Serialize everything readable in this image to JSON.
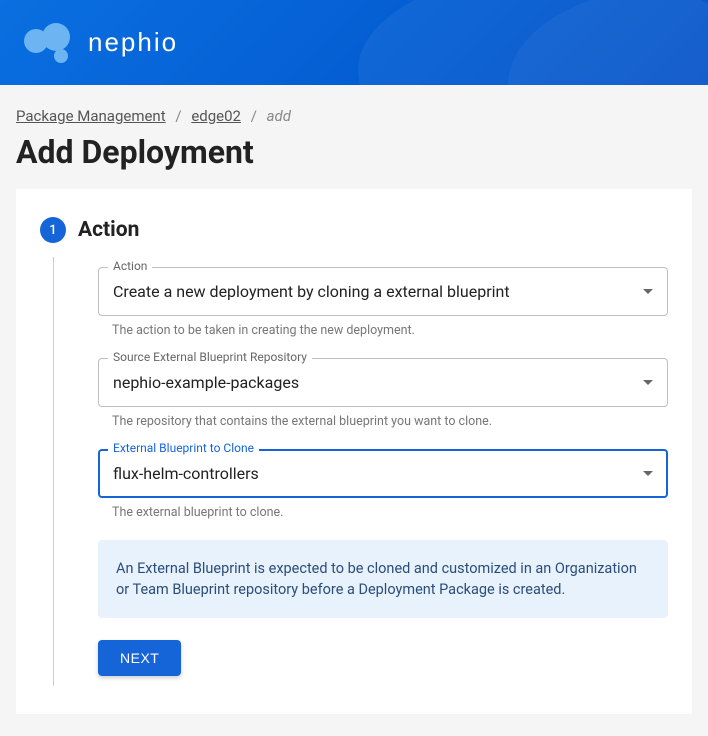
{
  "brand": "nephio",
  "breadcrumb": {
    "item0": "Package Management",
    "item1": "edge02",
    "current": "add"
  },
  "page_title": "Add Deployment",
  "step": {
    "number": "1",
    "title": "Action"
  },
  "fields": {
    "action": {
      "label": "Action",
      "value": "Create a new deployment by cloning a external blueprint",
      "helper": "The action to be taken in creating the new deployment."
    },
    "source_repo": {
      "label": "Source External Blueprint Repository",
      "value": "nephio-example-packages",
      "helper": "The repository that contains the external blueprint you want to clone."
    },
    "blueprint": {
      "label": "External Blueprint to Clone",
      "value": "flux-helm-controllers",
      "helper": "The external blueprint to clone."
    }
  },
  "info_message": "An External Blueprint is expected to be cloned and customized in an Organization or Team Blueprint repository before a Deployment Package is created.",
  "buttons": {
    "next": "NEXT"
  }
}
